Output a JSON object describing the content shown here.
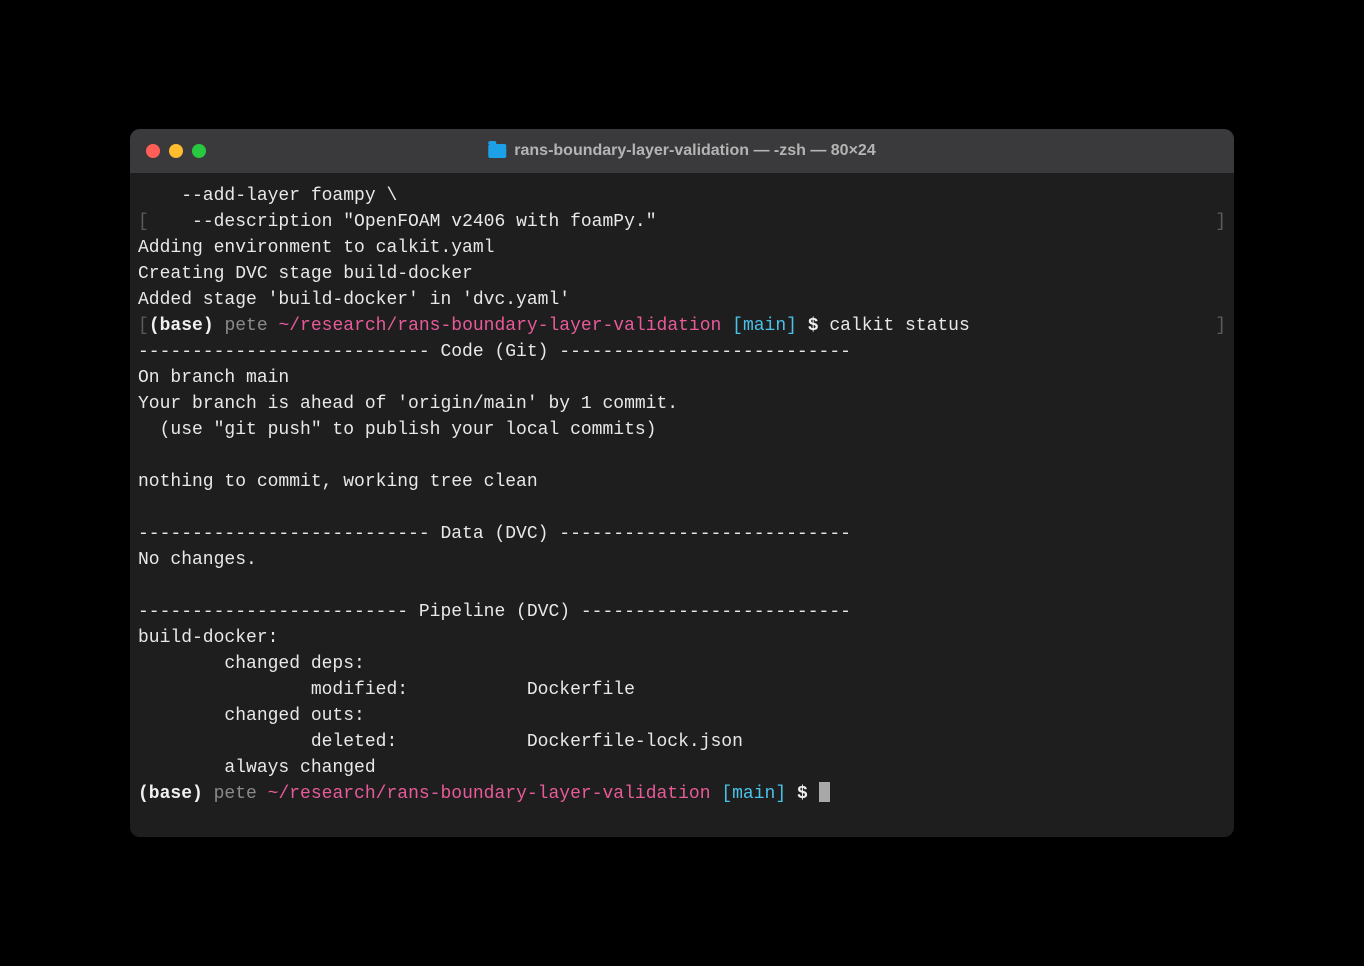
{
  "title": "rans-boundary-layer-validation — -zsh — 80×24",
  "lines": {
    "l1": "    --add-layer foampy \\",
    "l2_pre": "[",
    "l2": "    --description \"OpenFOAM v2406 with foamPy.\"",
    "l2_post": "]",
    "l3": "Adding environment to calkit.yaml",
    "l4": "Creating DVC stage build-docker",
    "l5": "Added stage 'build-docker' in 'dvc.yaml'",
    "prompt1": {
      "pre": "[",
      "base": "(base) ",
      "user": "pete ",
      "path": "~/research/rans-boundary-layer-validation ",
      "branch": "[main]",
      "dollar": " $ ",
      "cmd": "calkit status",
      "post": "]"
    },
    "l7": "--------------------------- Code (Git) ---------------------------",
    "l8": "On branch main",
    "l9": "Your branch is ahead of 'origin/main' by 1 commit.",
    "l10": "  (use \"git push\" to publish your local commits)",
    "l11": "",
    "l12": "nothing to commit, working tree clean",
    "l13": "",
    "l14": "--------------------------- Data (DVC) ---------------------------",
    "l15": "No changes.",
    "l16": "",
    "l17": "------------------------- Pipeline (DVC) -------------------------",
    "l18": "build-docker:",
    "l19": "        changed deps:",
    "l20": "                modified:           Dockerfile",
    "l21": "        changed outs:",
    "l22": "                deleted:            Dockerfile-lock.json",
    "l23": "        always changed",
    "prompt2": {
      "base": "(base) ",
      "user": "pete ",
      "path": "~/research/rans-boundary-layer-validation ",
      "branch": "[main]",
      "dollar": " $ "
    }
  }
}
